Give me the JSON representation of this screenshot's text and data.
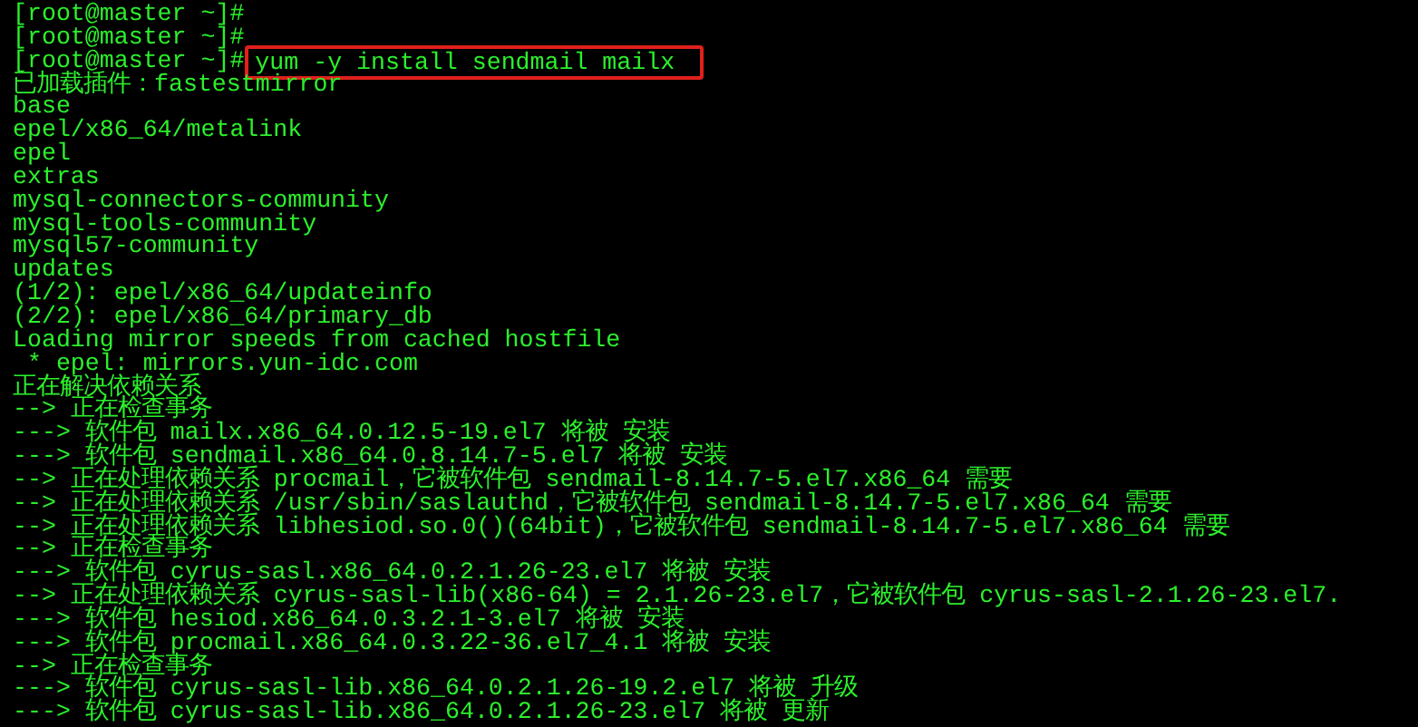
{
  "terminal": {
    "lines": [
      {
        "kind": "prompt",
        "prompt": "[root@master ~]#"
      },
      {
        "kind": "prompt",
        "prompt": "[root@master ~]#"
      },
      {
        "kind": "prompt",
        "prompt": "[root@master ~]#",
        "command": "yum -y install sendmail mailx",
        "highlighted": true
      },
      {
        "kind": "output",
        "text": "已加载插件：fastestmirror"
      },
      {
        "kind": "output",
        "text": "base"
      },
      {
        "kind": "output",
        "text": "epel/x86_64/metalink"
      },
      {
        "kind": "output",
        "text": "epel"
      },
      {
        "kind": "output",
        "text": "extras"
      },
      {
        "kind": "output",
        "text": "mysql-connectors-community"
      },
      {
        "kind": "output",
        "text": "mysql-tools-community"
      },
      {
        "kind": "output",
        "text": "mysql57-community"
      },
      {
        "kind": "output",
        "text": "updates"
      },
      {
        "kind": "output",
        "text": "(1/2): epel/x86_64/updateinfo"
      },
      {
        "kind": "output",
        "text": "(2/2): epel/x86_64/primary_db"
      },
      {
        "kind": "output",
        "text": "Loading mirror speeds from cached hostfile"
      },
      {
        "kind": "output",
        "text": " * epel: mirrors.yun-idc.com"
      },
      {
        "kind": "output",
        "text": "正在解决依赖关系"
      },
      {
        "kind": "output",
        "text": "--> 正在检查事务"
      },
      {
        "kind": "output",
        "text": "---> 软件包 mailx.x86_64.0.12.5-19.el7 将被 安装"
      },
      {
        "kind": "output",
        "text": "---> 软件包 sendmail.x86_64.0.8.14.7-5.el7 将被 安装"
      },
      {
        "kind": "output",
        "text": "--> 正在处理依赖关系 procmail，它被软件包 sendmail-8.14.7-5.el7.x86_64 需要"
      },
      {
        "kind": "output",
        "text": "--> 正在处理依赖关系 /usr/sbin/saslauthd，它被软件包 sendmail-8.14.7-5.el7.x86_64 需要"
      },
      {
        "kind": "output",
        "text": "--> 正在处理依赖关系 libhesiod.so.0()(64bit)，它被软件包 sendmail-8.14.7-5.el7.x86_64 需要"
      },
      {
        "kind": "output",
        "text": "--> 正在检查事务"
      },
      {
        "kind": "output",
        "text": "---> 软件包 cyrus-sasl.x86_64.0.2.1.26-23.el7 将被 安装"
      },
      {
        "kind": "output",
        "text": "--> 正在处理依赖关系 cyrus-sasl-lib(x86-64) = 2.1.26-23.el7，它被软件包 cyrus-sasl-2.1.26-23.el7."
      },
      {
        "kind": "output",
        "text": "---> 软件包 hesiod.x86_64.0.3.2.1-3.el7 将被 安装"
      },
      {
        "kind": "output",
        "text": "---> 软件包 procmail.x86_64.0.3.22-36.el7_4.1 将被 安装"
      },
      {
        "kind": "output",
        "text": "--> 正在检查事务"
      },
      {
        "kind": "output",
        "text": "---> 软件包 cyrus-sasl-lib.x86_64.0.2.1.26-19.2.el7 将被 升级"
      },
      {
        "kind": "output",
        "text": "---> 软件包 cyrus-sasl-lib.x86_64.0.2.1.26-23.el7 将被 更新"
      }
    ]
  }
}
